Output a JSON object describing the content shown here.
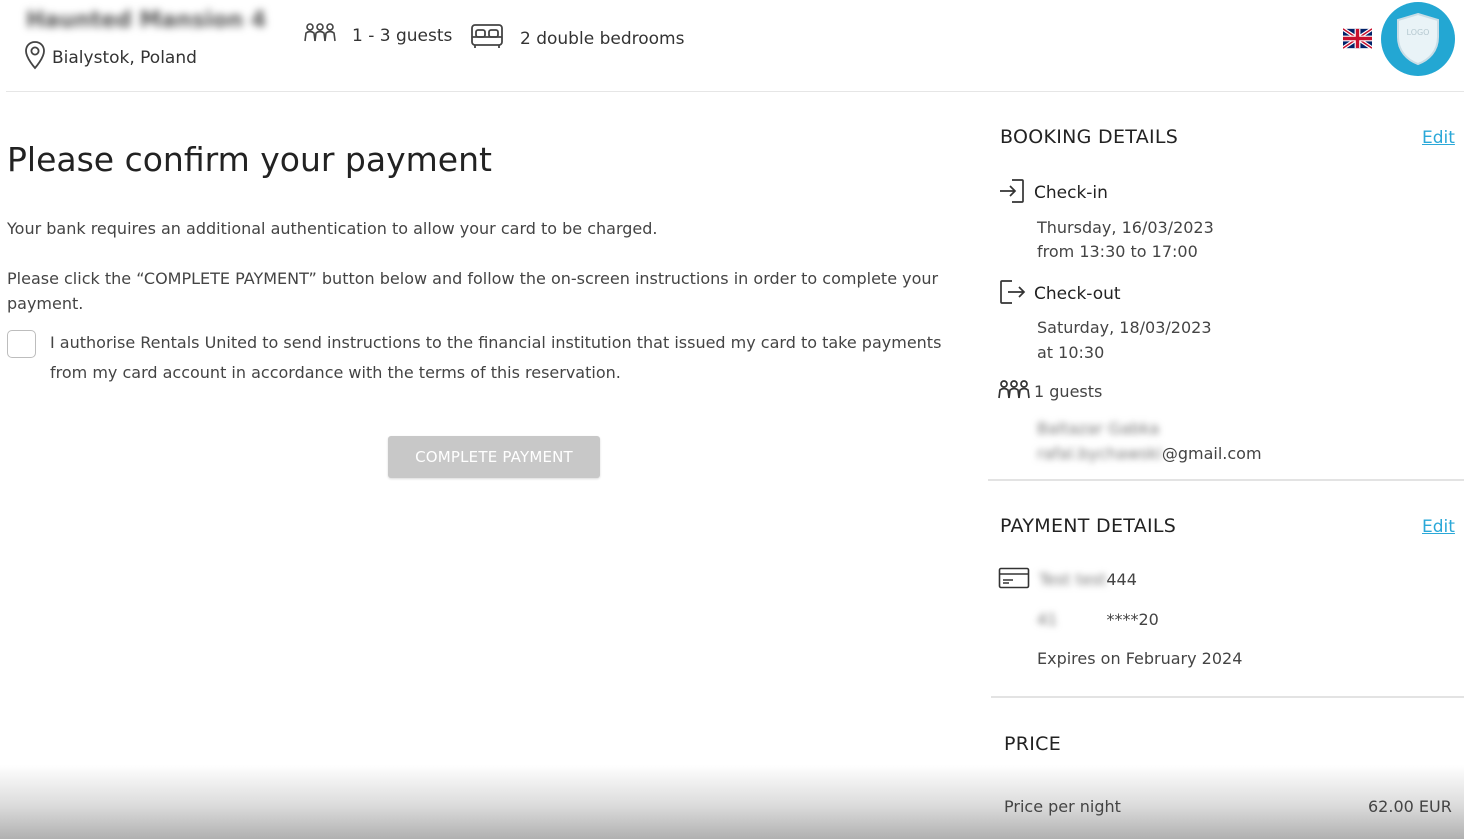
{
  "header": {
    "property_name": "Haunted Mansion 4",
    "location": "Bialystok, Poland",
    "guests_feature": "1 - 3 guests",
    "bedrooms_feature": "2 double bedrooms",
    "language_flag": "uk-flag-icon",
    "logo_text": "LOGO",
    "logo_color": "#23a7d3"
  },
  "main": {
    "title": "Please confirm your payment",
    "paragraph1": "Your bank requires an additional authentication to allow your card to be charged.",
    "paragraph2": "Please click the “COMPLETE PAYMENT” button below and follow the on-screen instructions in order to complete your payment.",
    "consent_text": "I authorise Rentals United to send instructions to the financial institution that issued my card to take payments from my card account in accordance with the terms of this reservation.",
    "complete_button": "COMPLETE PAYMENT"
  },
  "booking": {
    "heading": "BOOKING DETAILS",
    "edit": "Edit",
    "checkin_label": "Check-in",
    "checkin_date": "Thursday, 16/03/2023",
    "checkin_time": "from 13:30 to 17:00",
    "checkout_label": "Check-out",
    "checkout_date": "Saturday, 18/03/2023",
    "checkout_time": "at 10:30",
    "guests": "1 guests",
    "guest_name": "Baltazar Gabka",
    "email_local": "rafal.bychawski",
    "email_domain": "@gmail.com"
  },
  "payment": {
    "heading": "PAYMENT DETAILS",
    "edit": "Edit",
    "card_holder": "Test test",
    "card_last": "444",
    "card_number_prefix": "41",
    "card_number_suffix": "****20",
    "expires": "Expires on February 2024"
  },
  "price": {
    "heading": "PRICE",
    "per_night_label": "Price per night",
    "per_night_value": "62.00 EUR"
  },
  "colors": {
    "link": "#2aa8d8",
    "button_disabled": "#c8c8c8",
    "logo": "#23a7d3"
  }
}
